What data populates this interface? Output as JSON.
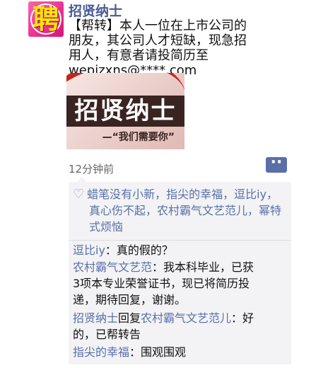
{
  "post": {
    "avatar_char": "聘",
    "username": "招贤纳士",
    "text_lines": [
      "【帮转】本人一位在上市公司的",
      "朋友，其公司人才短缺，现急招",
      "用人，有意者请投简历至",
      "wepizxns@****.com"
    ],
    "image": {
      "title": "招贤纳士",
      "subtitle": "—“我们需要你”"
    },
    "timestamp": "12分钟前"
  },
  "likes": {
    "icon": "heart-outline-icon",
    "line1": "蜡笔没有小新，指尖的幸福，逗比iy，",
    "line2": "真心伤不起，农村霸气文艺范儿，幂特",
    "line3": "式烦恼"
  },
  "comments": [
    {
      "author": "逗比iy",
      "lines": [
        "：真的假的？"
      ]
    },
    {
      "author": "农村霸气文艺范",
      "lines": [
        "：我本科毕业，已获",
        "3项本专业荣誉证书，现已将简历投",
        "递，期待回复，谢谢。"
      ]
    },
    {
      "author": "招贤纳士",
      "reply_word": "回复",
      "reply_to": "农村霸气文艺范儿",
      "lines": [
        "：好",
        "的，已帮转告"
      ]
    },
    {
      "author": "指尖的幸福",
      "lines": [
        "：围观围观"
      ]
    }
  ],
  "colors": {
    "name_blue": "#5a6fa8",
    "comment_bg": "#f3f3f5"
  }
}
